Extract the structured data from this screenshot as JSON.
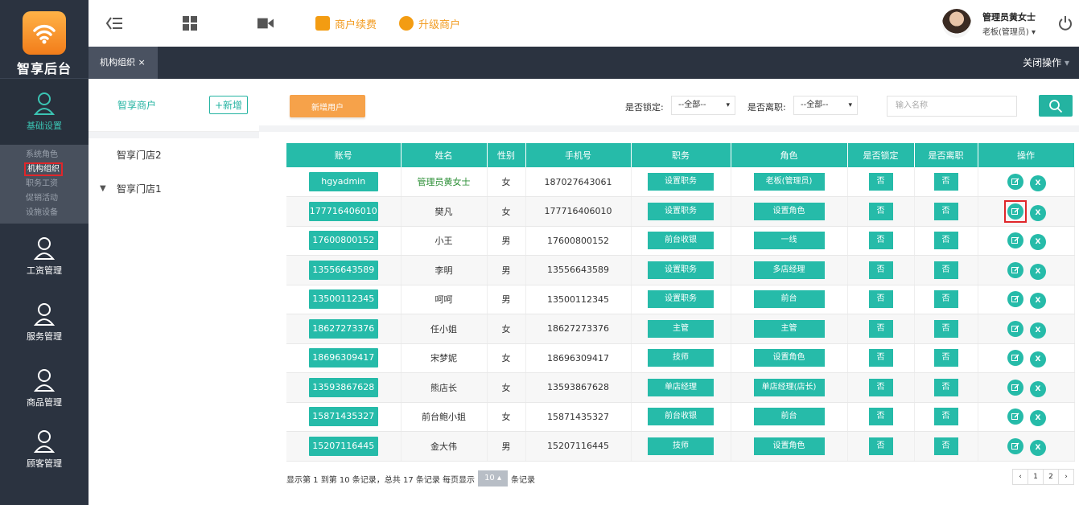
{
  "brand": {
    "name": "智享后台"
  },
  "sidebar": {
    "groups": [
      {
        "label": "基础设置",
        "active": true
      },
      {
        "label": "工资管理"
      },
      {
        "label": "服务管理"
      },
      {
        "label": "商品管理"
      },
      {
        "label": "顾客管理"
      }
    ],
    "subitems": [
      "系统角色",
      "机构组织",
      "职务工资",
      "促销活动",
      "设施设备"
    ]
  },
  "topbar": {
    "renew": "商户续费",
    "upgrade": "升级商户",
    "user_name": "管理员黄女士",
    "user_role": "老板(管理员)"
  },
  "tabs": {
    "active": "机构组织",
    "close_ops": "关闭操作"
  },
  "tree": {
    "title": "智享商户",
    "add": "+新增",
    "items": [
      "智享门店2",
      "智享门店1"
    ]
  },
  "filters": {
    "new_user": "新增用户",
    "locked_label": "是否锁定:",
    "locked_value": "--全部--",
    "left_label": "是否离职:",
    "left_value": "--全部--",
    "search_placeholder": "输入名称"
  },
  "table": {
    "headers": [
      "账号",
      "姓名",
      "性别",
      "手机号",
      "职务",
      "角色",
      "是否锁定",
      "是否离职",
      "操作"
    ],
    "rows": [
      {
        "account": "hgyadmin",
        "name": "管理员黄女士",
        "gender": "女",
        "phone": "187027643061",
        "job": "设置职务",
        "role": "老板(管理员)",
        "locked": "否",
        "left": "否"
      },
      {
        "account": "177716406010",
        "name": "樊凡",
        "gender": "女",
        "phone": "177716406010",
        "job": "设置职务",
        "role": "设置角色",
        "locked": "否",
        "left": "否"
      },
      {
        "account": "17600800152",
        "name": "小王",
        "gender": "男",
        "phone": "17600800152",
        "job": "前台收银",
        "role": "一线",
        "locked": "否",
        "left": "否"
      },
      {
        "account": "13556643589",
        "name": "李明",
        "gender": "男",
        "phone": "13556643589",
        "job": "设置职务",
        "role": "多店经理",
        "locked": "否",
        "left": "否"
      },
      {
        "account": "13500112345",
        "name": "呵呵",
        "gender": "男",
        "phone": "13500112345",
        "job": "设置职务",
        "role": "前台",
        "locked": "否",
        "left": "否"
      },
      {
        "account": "18627273376",
        "name": "任小姐",
        "gender": "女",
        "phone": "18627273376",
        "job": "主管",
        "role": "主管",
        "locked": "否",
        "left": "否"
      },
      {
        "account": "18696309417",
        "name": "宋梦妮",
        "gender": "女",
        "phone": "18696309417",
        "job": "技师",
        "role": "设置角色",
        "locked": "否",
        "left": "否"
      },
      {
        "account": "13593867628",
        "name": "熊店长",
        "gender": "女",
        "phone": "13593867628",
        "job": "单店经理",
        "role": "单店经理(店长)",
        "locked": "否",
        "left": "否"
      },
      {
        "account": "15871435327",
        "name": "前台鲍小姐",
        "gender": "女",
        "phone": "15871435327",
        "job": "前台收银",
        "role": "前台",
        "locked": "否",
        "left": "否"
      },
      {
        "account": "15207116445",
        "name": "金大伟",
        "gender": "男",
        "phone": "15207116445",
        "job": "技师",
        "role": "设置角色",
        "locked": "否",
        "left": "否"
      }
    ],
    "op_delete": "X"
  },
  "footer": {
    "summary": "显示第 1 到第 10 条记录，总共 17 条记录 每页显示",
    "page_size": "10 ▴",
    "suffix": "条记录",
    "pager": [
      "‹",
      "1",
      "2",
      "›"
    ]
  },
  "colors": {
    "teal": "#26bba9",
    "orange": "#f6a24a",
    "sidebar": "#2b3340"
  }
}
